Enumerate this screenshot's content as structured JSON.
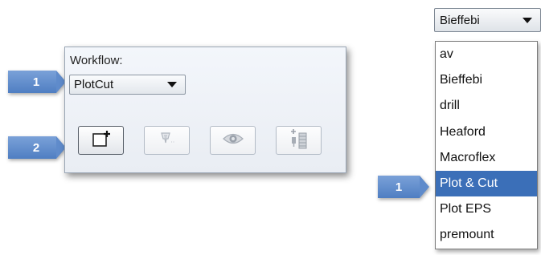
{
  "workflow_panel": {
    "label": "Workflow:",
    "selected": "PlotCut",
    "buttons": [
      {
        "name": "new-job",
        "icon": "new-document-plus-icon",
        "enabled": true
      },
      {
        "name": "plot",
        "icon": "plotter-head-icon",
        "enabled": false
      },
      {
        "name": "preview",
        "icon": "eye-icon",
        "enabled": false
      },
      {
        "name": "layout",
        "icon": "layout-plus-icon",
        "enabled": false
      }
    ]
  },
  "callouts": [
    {
      "number": "1",
      "color": "#5f8bcb"
    },
    {
      "number": "2",
      "color": "#5f8bcb"
    },
    {
      "number": "1",
      "color": "#5f8bcb"
    }
  ],
  "dropdown": {
    "current": "Bieffebi",
    "items": [
      "av",
      "Bieffebi",
      "drill",
      "Heaford",
      "Macroflex",
      "Plot & Cut",
      "Plot EPS",
      "premount"
    ],
    "selected_index": 5,
    "highlight_color": "#3b6fb8"
  }
}
